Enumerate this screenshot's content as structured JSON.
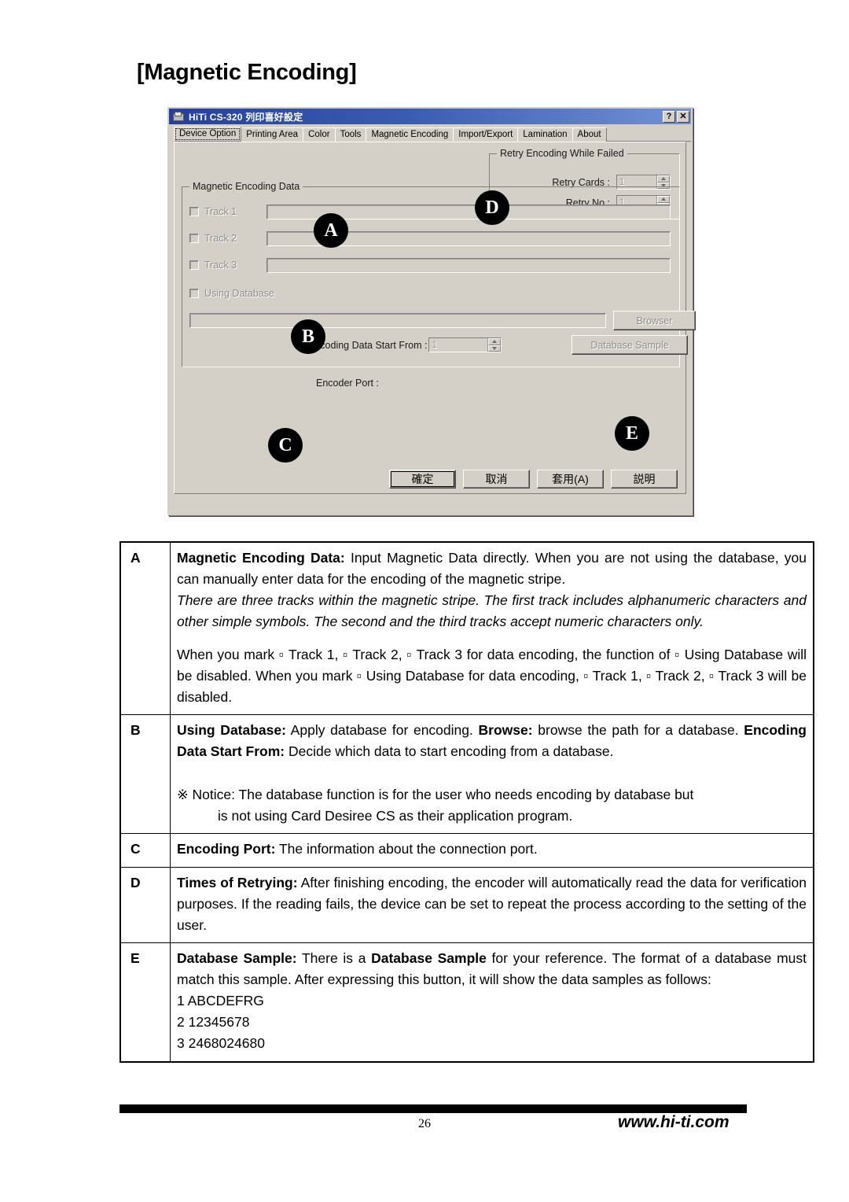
{
  "page": {
    "heading": "[Magnetic Encoding]",
    "number": "26",
    "url": "www.hi-ti.com"
  },
  "dialog": {
    "title": "HiTi CS-320 列印喜好設定",
    "title_icon": "printer-icon",
    "help_button": "?",
    "close_button": "✕",
    "tabs": [
      {
        "label": "Device Option",
        "active": true
      },
      {
        "label": "Printing Area",
        "active": false
      },
      {
        "label": "Color",
        "active": false
      },
      {
        "label": "Tools",
        "active": false
      },
      {
        "label": "Magnetic Encoding",
        "active": false
      },
      {
        "label": "Import/Export",
        "active": false
      },
      {
        "label": "Lamination",
        "active": false
      },
      {
        "label": "About",
        "active": false
      }
    ],
    "retry_group": {
      "title": "Retry Encoding While Failed",
      "retry_cards_label": "Retry Cards :",
      "retry_cards_value": "1",
      "retry_no_label": "Retry No :",
      "retry_no_value": "1"
    },
    "mag_group": {
      "title": "Magnetic Encoding Data",
      "tracks": [
        {
          "label": "Track 1",
          "value": ""
        },
        {
          "label": "Track 2",
          "value": ""
        },
        {
          "label": "Track 3",
          "value": ""
        }
      ],
      "using_database_label": "Using Database",
      "database_path_value": "",
      "browser_button": "Browser",
      "start_from_label": "Encoding Data Start From :",
      "start_from_value": "1",
      "database_sample_button": "Database Sample"
    },
    "encoder_port_label": "Encoder Port :",
    "buttons": [
      {
        "label": "確定",
        "default": true
      },
      {
        "label": "取消",
        "default": false
      },
      {
        "label": "套用(A)",
        "default": false
      },
      {
        "label": "説明",
        "default": false
      }
    ]
  },
  "markers": {
    "a": "A",
    "b": "B",
    "c": "C",
    "d": "D",
    "e": "E"
  },
  "descriptions": {
    "a": {
      "key": "A",
      "term": "Magnetic Encoding Data:",
      "p1_rest": " Input Magnetic Data directly. When you are not using the database, you can manually enter data for the encoding of the magnetic stripe.",
      "p2_italic": "There are three tracks within the magnetic stripe.   The first track includes alphanumeric characters and other simple symbols.   The second and the third tracks accept numeric characters only.",
      "p3": "When you mark ▫ Track 1, ▫ Track 2, ▫ Track 3 for data encoding, the function of ▫ Using Database will be disabled.   When you mark ▫ Using Database for data encoding, ▫ Track 1, ▫ Track 2, ▫ Track 3 will be disabled."
    },
    "b": {
      "key": "B",
      "term1": "Using Database:",
      "t1_rest": " Apply database for encoding. ",
      "term2": "Browse:",
      "t2_rest": " browse the path for a database. ",
      "term3": "Encoding Data Start From:",
      "t3_rest": " Decide which data to start encoding from a database.",
      "notice_line1": "※ Notice: The database function is for the user who needs encoding by database but",
      "notice_line2": "is not using Card Desiree CS as their application program."
    },
    "c": {
      "key": "C",
      "term": "Encoding Port:",
      "rest": " The information about the connection port."
    },
    "d": {
      "key": "D",
      "term": "Times of Retrying:",
      "rest": " After finishing encoding, the encoder will automatically read the data for verification purposes.   If the reading fails, the device can be set to repeat the process according to the setting of the user."
    },
    "e": {
      "key": "E",
      "term1": "Database Sample:",
      "t1_rest": " There is a ",
      "term2": "Database Sample",
      "t2_rest": " for your reference. The format of a database must match this sample. After expressing this button, it will show the data samples as follows:",
      "samples": [
        "1 ABCDEFRG",
        "2 12345678",
        "3 2468024680"
      ]
    }
  },
  "colors": {
    "dialog_face": "#d4d0c8",
    "titlebar_start": "#27409a",
    "titlebar_end": "#7391d4",
    "marker_bg": "#000000",
    "marker_fg": "#ffffff"
  }
}
